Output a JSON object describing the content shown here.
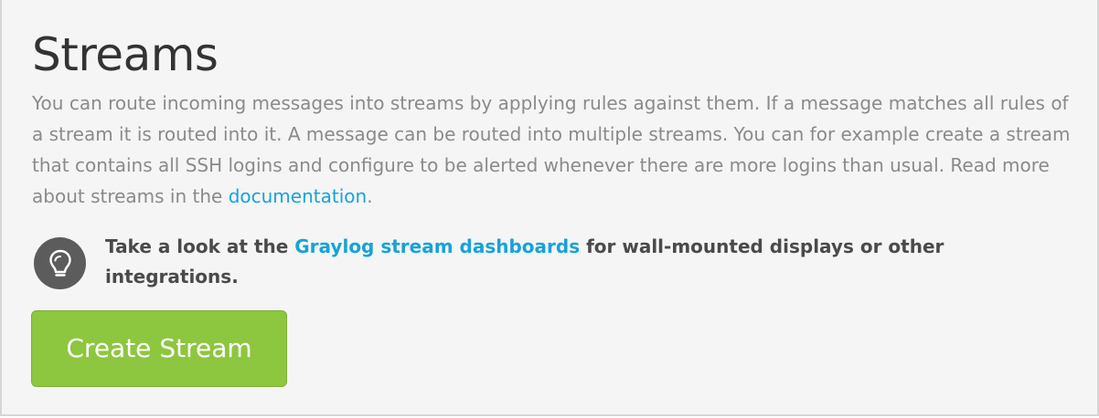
{
  "page": {
    "title": "Streams",
    "description_text": "You can route incoming messages into streams by applying rules against them. If a message matches all rules of a stream it is routed into it. A message can be routed into multiple streams. You can for example create a stream that contains all SSH logins and configure to be alerted whenever there are more logins than usual. Read more about streams in the ",
    "description_link": "documentation",
    "description_end": "."
  },
  "tip": {
    "icon": "lightbulb-icon",
    "prefix": "Take a look at the ",
    "link": "Graylog stream dashboards",
    "suffix": " for wall-mounted displays or other integrations."
  },
  "actions": {
    "create_stream_label": "Create Stream"
  },
  "colors": {
    "link": "#16a3d8",
    "button": "#8dc63f",
    "panel_bg": "#f5f5f5",
    "icon_bg": "#5c5c5c"
  }
}
